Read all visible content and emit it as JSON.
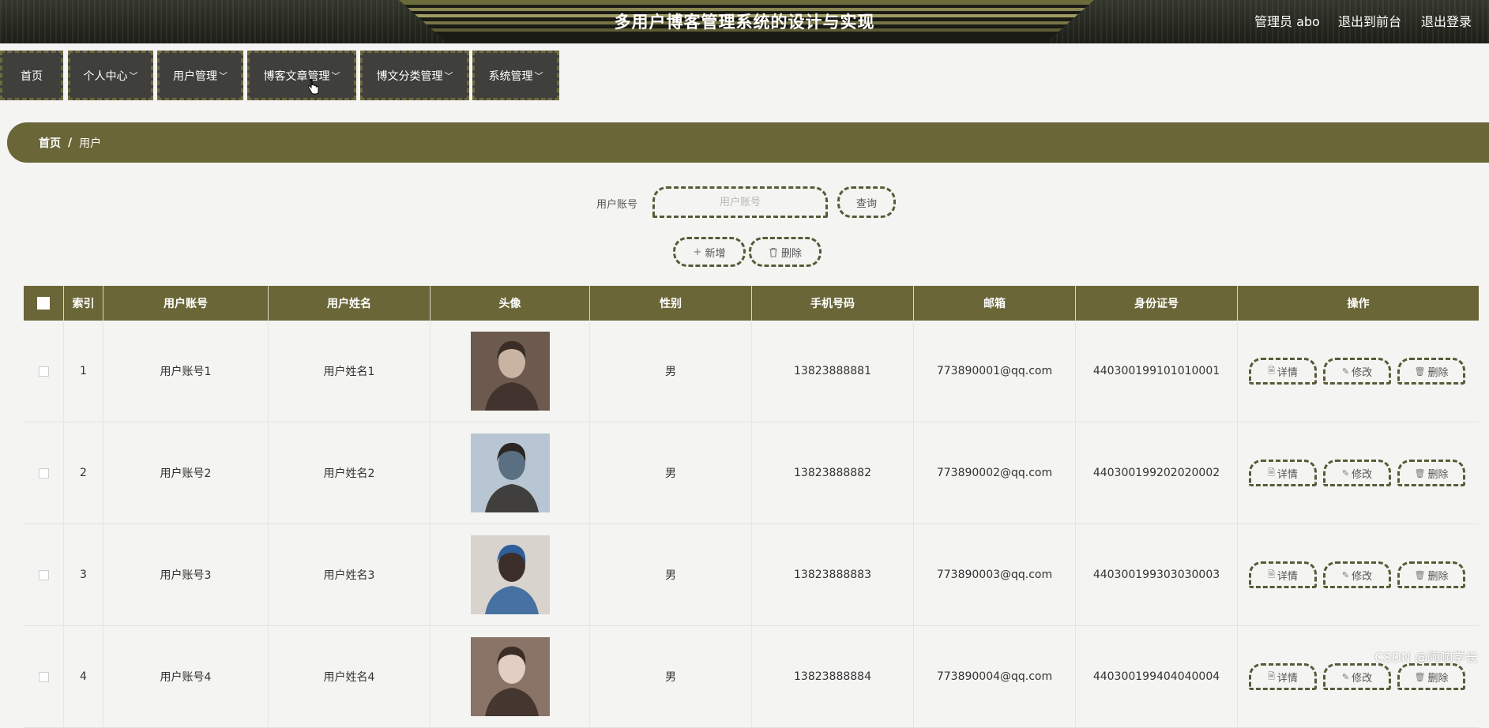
{
  "header": {
    "title": "多用户博客管理系统的设计与实现",
    "admin_label": "管理员 abo",
    "to_front": "退出到前台",
    "logout": "退出登录"
  },
  "nav": [
    {
      "label": "首页",
      "has_menu": false
    },
    {
      "label": "个人中心",
      "has_menu": true
    },
    {
      "label": "用户管理",
      "has_menu": true
    },
    {
      "label": "博客文章管理",
      "has_menu": true
    },
    {
      "label": "博文分类管理",
      "has_menu": true
    },
    {
      "label": "系统管理",
      "has_menu": true
    }
  ],
  "nav_chevron": "﹀",
  "breadcrumb": {
    "home": "首页",
    "sep": "/",
    "current": "用户"
  },
  "search": {
    "label": "用户账号",
    "placeholder": "用户账号",
    "button": "查询"
  },
  "actions": {
    "add": "新增",
    "delete": "删除"
  },
  "table": {
    "headers": [
      "",
      "索引",
      "用户账号",
      "用户姓名",
      "头像",
      "性别",
      "手机号码",
      "邮箱",
      "身份证号",
      "操作"
    ],
    "rows": [
      {
        "index": "1",
        "account": "用户账号1",
        "name": "用户姓名1",
        "gender": "男",
        "phone": "13823888881",
        "email": "773890001@qq.com",
        "id_card": "440300199101010001"
      },
      {
        "index": "2",
        "account": "用户账号2",
        "name": "用户姓名2",
        "gender": "男",
        "phone": "13823888882",
        "email": "773890002@qq.com",
        "id_card": "440300199202020002"
      },
      {
        "index": "3",
        "account": "用户账号3",
        "name": "用户姓名3",
        "gender": "男",
        "phone": "13823888883",
        "email": "773890003@qq.com",
        "id_card": "440300199303030003"
      },
      {
        "index": "4",
        "account": "用户账号4",
        "name": "用户姓名4",
        "gender": "男",
        "phone": "13823888884",
        "email": "773890004@qq.com",
        "id_card": "440300199404040004"
      }
    ],
    "row_actions": {
      "detail": "详情",
      "edit": "修改",
      "delete": "删除"
    }
  },
  "icons": {
    "add": "plus-icon",
    "delete": "trash-icon",
    "detail": "document-icon",
    "edit": "pencil-icon"
  },
  "watermark": "CSDN @阿响学长"
}
